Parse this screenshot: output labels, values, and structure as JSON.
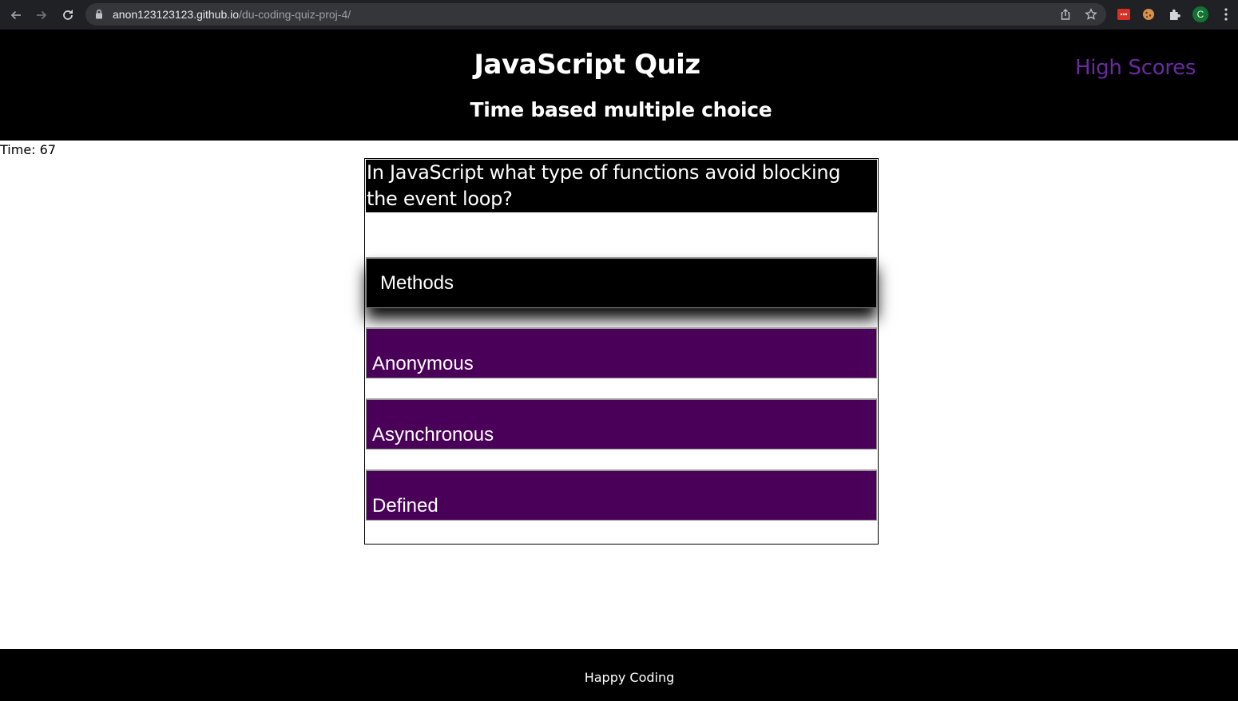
{
  "browser": {
    "url_host": "anon123123123.github.io",
    "url_path": "/du-coding-quiz-proj-4/",
    "profile_initial": "C",
    "icons": [
      "back-icon",
      "forward-icon",
      "reload-icon",
      "lock-icon",
      "share-icon",
      "bookmark-star-icon",
      "extension-icon",
      "puzzle-icon",
      "menu-dots-icon"
    ]
  },
  "header": {
    "title": "JavaScript Quiz",
    "subtitle": "Time based multiple choice",
    "high_scores_link": "High Scores"
  },
  "timer": {
    "text": "Time: 67"
  },
  "quiz": {
    "question": "In JavaScript what type of functions avoid blocking the event loop?",
    "choices": [
      "Methods",
      "Anonymous",
      "Asynchronous",
      "Defined"
    ]
  },
  "footer": {
    "text": "Happy Coding"
  },
  "colors": {
    "header_bg": "#000000",
    "link": "#6a2aa0",
    "choice_bg": "#4a0058",
    "choice_hover_bg": "#000000"
  }
}
